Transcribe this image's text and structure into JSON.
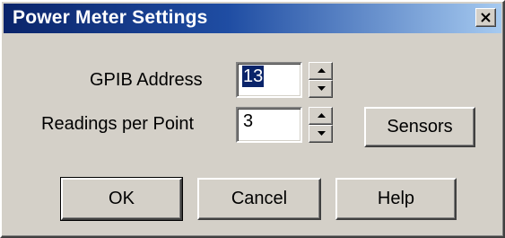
{
  "window": {
    "title": "Power Meter Settings"
  },
  "form": {
    "gpib_label": "GPIB Address",
    "gpib_value": "13",
    "readings_label": "Readings per Point",
    "readings_value": "3"
  },
  "buttons": {
    "sensors": "Sensors",
    "ok": "OK",
    "cancel": "Cancel",
    "help": "Help"
  },
  "icons": {
    "close": "close-icon",
    "spin_up": "spin-up-arrow-icon",
    "spin_down": "spin-down-arrow-icon"
  },
  "colors": {
    "title_gradient_start": "#0a246a",
    "title_gradient_end": "#a6caf0",
    "face": "#d4d0c8",
    "selection": "#0a246a"
  }
}
